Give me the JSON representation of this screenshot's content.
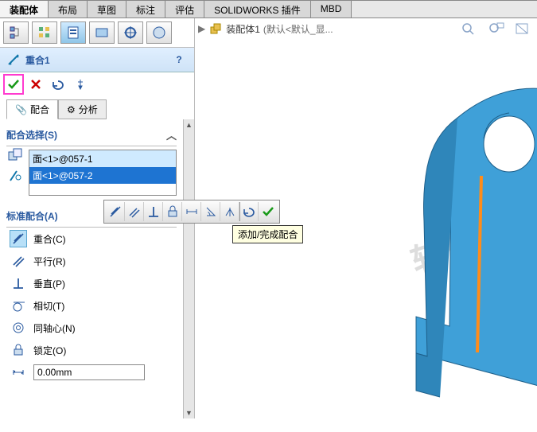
{
  "tabs": [
    "装配体",
    "布局",
    "草图",
    "标注",
    "评估",
    "SOLIDWORKS 插件",
    "MBD"
  ],
  "activeTab": 0,
  "breadcrumb": {
    "doc": "装配体1",
    "state": "(默认<默认_显..."
  },
  "panel": {
    "title": "重合1",
    "subtabs": {
      "mate": "配合",
      "analyze": "分析"
    },
    "selection": {
      "heading": "配合选择(S)",
      "items": [
        "面<1>@057-1",
        "面<1>@057-2"
      ]
    },
    "standard": {
      "heading": "标准配合(A)",
      "items": [
        {
          "icon": "coincident",
          "label": "重合(C)",
          "sel": true
        },
        {
          "icon": "parallel",
          "label": "平行(R)"
        },
        {
          "icon": "perpendicular",
          "label": "垂直(P)"
        },
        {
          "icon": "tangent",
          "label": "相切(T)"
        },
        {
          "icon": "concentric",
          "label": "同轴心(N)"
        },
        {
          "icon": "lock",
          "label": "锁定(O)"
        }
      ],
      "distance": "0.00mm"
    }
  },
  "tooltip": "添加/完成配合"
}
